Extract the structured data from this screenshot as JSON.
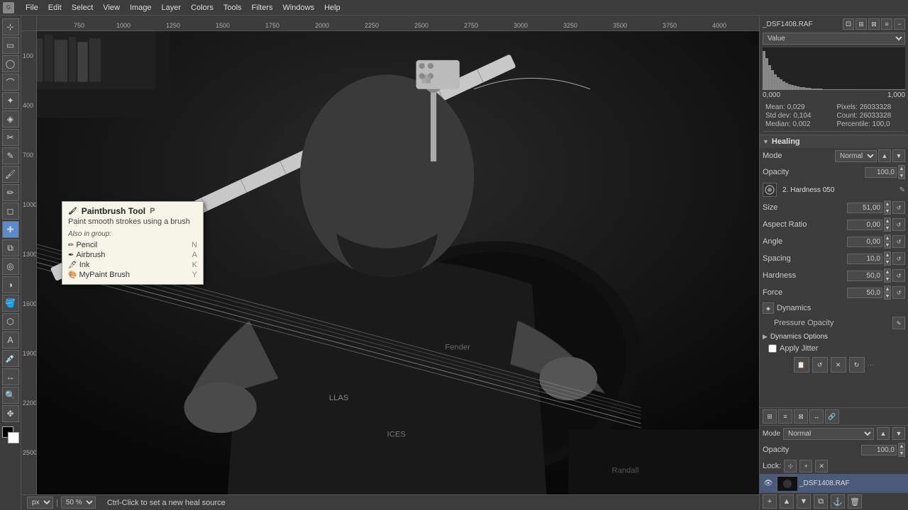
{
  "menubar": {
    "items": [
      "File",
      "Edit",
      "Select",
      "View",
      "Image",
      "Layer",
      "Colors",
      "Tools",
      "Filters",
      "Windows",
      "Help"
    ]
  },
  "app_title": "_DSF1408.RAF",
  "histogram": {
    "channel_label": "Value",
    "min_value": "0,000",
    "max_value": "1,000",
    "mean": "Mean: 0,029",
    "std_dev": "Std dev: 0,104",
    "median": "Median: 0,002",
    "pixels": "Pixels: 26033328",
    "count": "Count: 26033328",
    "percentile": "Percentile: 100,0"
  },
  "tool_tooltip": {
    "title": "Paintbrush Tool",
    "shortcut": "P",
    "description": "Paint smooth strokes using a brush",
    "group_label": "Also in group:",
    "group_items": [
      {
        "name": "Pencil",
        "shortcut": "N",
        "icon": "✏"
      },
      {
        "name": "Airbrush",
        "shortcut": "A",
        "icon": "✒"
      },
      {
        "name": "Ink",
        "shortcut": "K",
        "icon": "🖊"
      },
      {
        "name": "MyPaint Brush",
        "shortcut": "Y",
        "icon": "🖌"
      }
    ]
  },
  "tool_options": {
    "section_title": "Healing",
    "mode_label": "Mode",
    "mode_value": "Normal",
    "opacity_label": "Opacity",
    "opacity_value": "100,0",
    "brush_label": "Brush",
    "brush_value": "2. Hardness 050",
    "size_label": "Size",
    "size_value": "51,00",
    "aspect_ratio_label": "Aspect Ratio",
    "aspect_ratio_value": "0,00",
    "angle_label": "Angle",
    "angle_value": "0,00",
    "spacing_label": "Spacing",
    "spacing_value": "10,0",
    "hardness_label": "Hardness",
    "hardness_value": "50,0",
    "force_label": "Force",
    "force_value": "50,0",
    "dynamics_label": "Dynamics",
    "dynamics_value": "Pressure Opacity",
    "dynamics_options_label": "Dynamics Options",
    "apply_jitter_label": "Apply Jitter"
  },
  "layer_panel": {
    "mode_label": "Mode",
    "mode_value": "Normal",
    "opacity_label": "Opacity",
    "opacity_value": "100,0",
    "lock_label": "Lock:",
    "layer_name": "_DSF1408.RAF"
  },
  "statusbar": {
    "unit": "px",
    "zoom": "50 %",
    "tip": "Ctrl-Click to set a new heal source"
  }
}
